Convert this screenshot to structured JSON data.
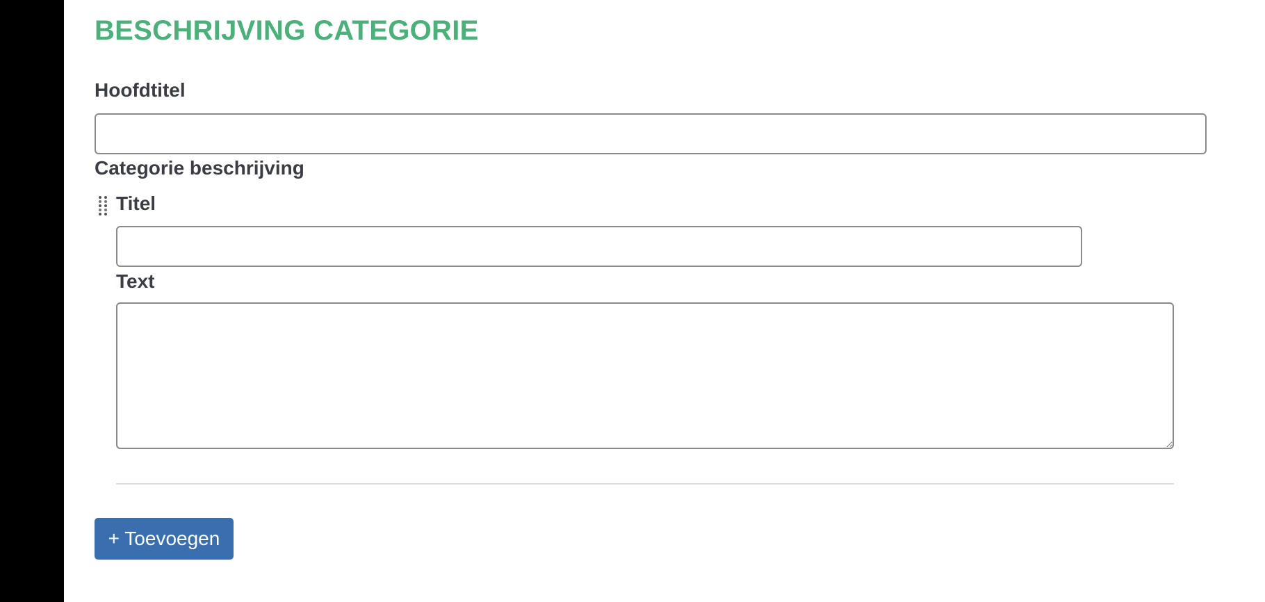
{
  "section": {
    "title": "BESCHRIJVING CATEGORIE"
  },
  "form": {
    "hoofdtitel_label": "Hoofdtitel",
    "hoofdtitel_value": "",
    "categorie_label": "Categorie beschrijving",
    "item": {
      "titel_label": "Titel",
      "titel_value": "",
      "text_label": "Text",
      "text_value": ""
    },
    "add_button_label": "+ Toevoegen"
  },
  "icons": {
    "drag_handle": "drag-handle-icon"
  },
  "colors": {
    "title_green": "#4cb07a",
    "button_blue": "#3a6fae",
    "label_text": "#3b3d45",
    "sidebar": "#000000"
  }
}
